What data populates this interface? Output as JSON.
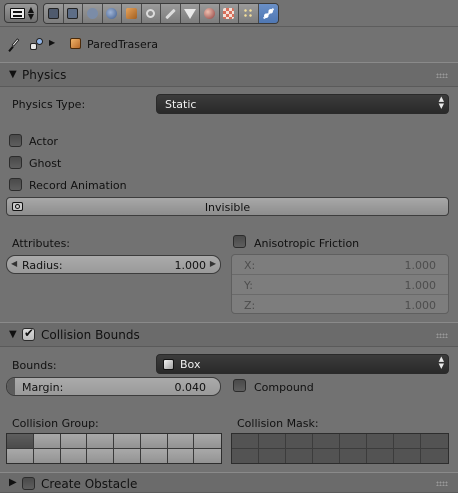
{
  "toolbar": {
    "tabs": [
      {
        "icon": "render-icon",
        "color": "#4f5a6d"
      },
      {
        "icon": "render-layers-icon",
        "color": "#5d6d86"
      },
      {
        "icon": "scene-icon",
        "color": "#7b8ca7"
      },
      {
        "icon": "world-icon",
        "color": "#4e6a9a"
      },
      {
        "icon": "object-icon",
        "color": "#c7843d"
      },
      {
        "icon": "constraints-icon",
        "color": "#6a6a6a"
      },
      {
        "icon": "modifiers-icon",
        "color": "#5b6f8f"
      },
      {
        "icon": "data-icon",
        "color": "#3c3c3c"
      },
      {
        "icon": "material-icon",
        "color": "#8a4d4d"
      },
      {
        "icon": "texture-icon",
        "color": "#b26b57"
      },
      {
        "icon": "particles-icon",
        "color": "#9c8c4f"
      },
      {
        "icon": "physics-icon",
        "color": "#e8eef8",
        "active": true
      }
    ]
  },
  "breadcrumb": {
    "object_name": "ParedTrasera"
  },
  "physics": {
    "title": "Physics",
    "type_label": "Physics Type:",
    "type_value": "Static",
    "actor_label": "Actor",
    "ghost_label": "Ghost",
    "record_label": "Record Animation",
    "invisible_label": "Invisible",
    "attributes_label": "Attributes:",
    "radius_label": "Radius:",
    "radius_value": "1.000",
    "aniso_label": "Anisotropic Friction",
    "x_label": "X:",
    "x_value": "1.000",
    "y_label": "Y:",
    "y_value": "1.000",
    "z_label": "Z:",
    "z_value": "1.000"
  },
  "collision": {
    "title": "Collision Bounds",
    "enabled": true,
    "bounds_label": "Bounds:",
    "bounds_value": "Box",
    "margin_label": "Margin:",
    "margin_value": "0.040",
    "compound_label": "Compound",
    "group_label": "Collision Group:",
    "mask_label": "Collision Mask:"
  },
  "obstacle": {
    "title": "Create Obstacle"
  }
}
